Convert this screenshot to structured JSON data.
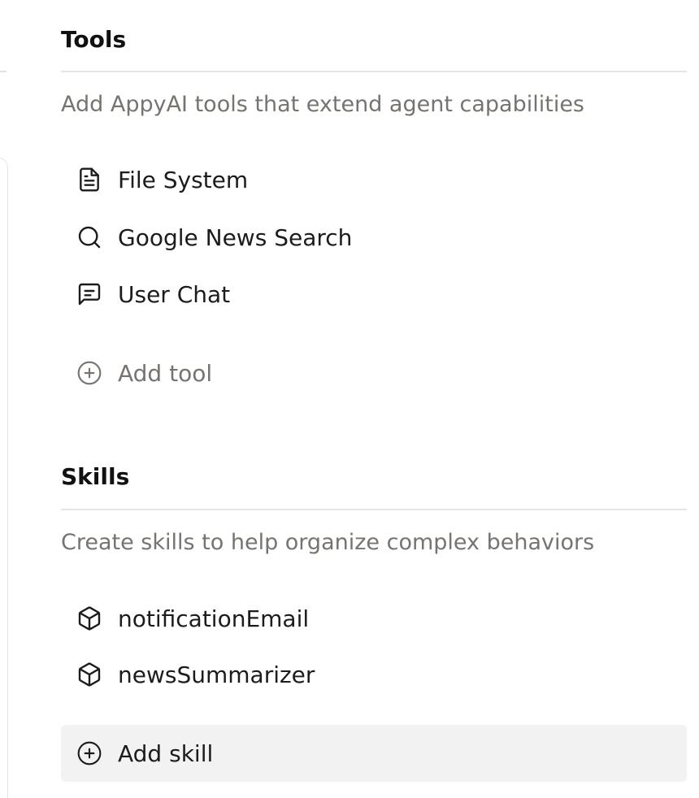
{
  "tools": {
    "title": "Tools",
    "description": "Add AppyAI tools that extend agent capabilities",
    "items": [
      {
        "label": "File System",
        "icon": "file-text-icon"
      },
      {
        "label": "Google News Search",
        "icon": "search-icon"
      },
      {
        "label": "User Chat",
        "icon": "message-square-icon"
      }
    ],
    "add_label": "Add tool"
  },
  "skills": {
    "title": "Skills",
    "description": "Create skills to help organize complex behaviors",
    "items": [
      {
        "label": "notificationEmail",
        "icon": "box-icon"
      },
      {
        "label": "newsSummarizer",
        "icon": "box-icon"
      }
    ],
    "add_label": "Add skill"
  },
  "colors": {
    "muted_text": "#77736f",
    "divider": "#e5e5e5",
    "hover_bg": "#f2f2f3"
  }
}
